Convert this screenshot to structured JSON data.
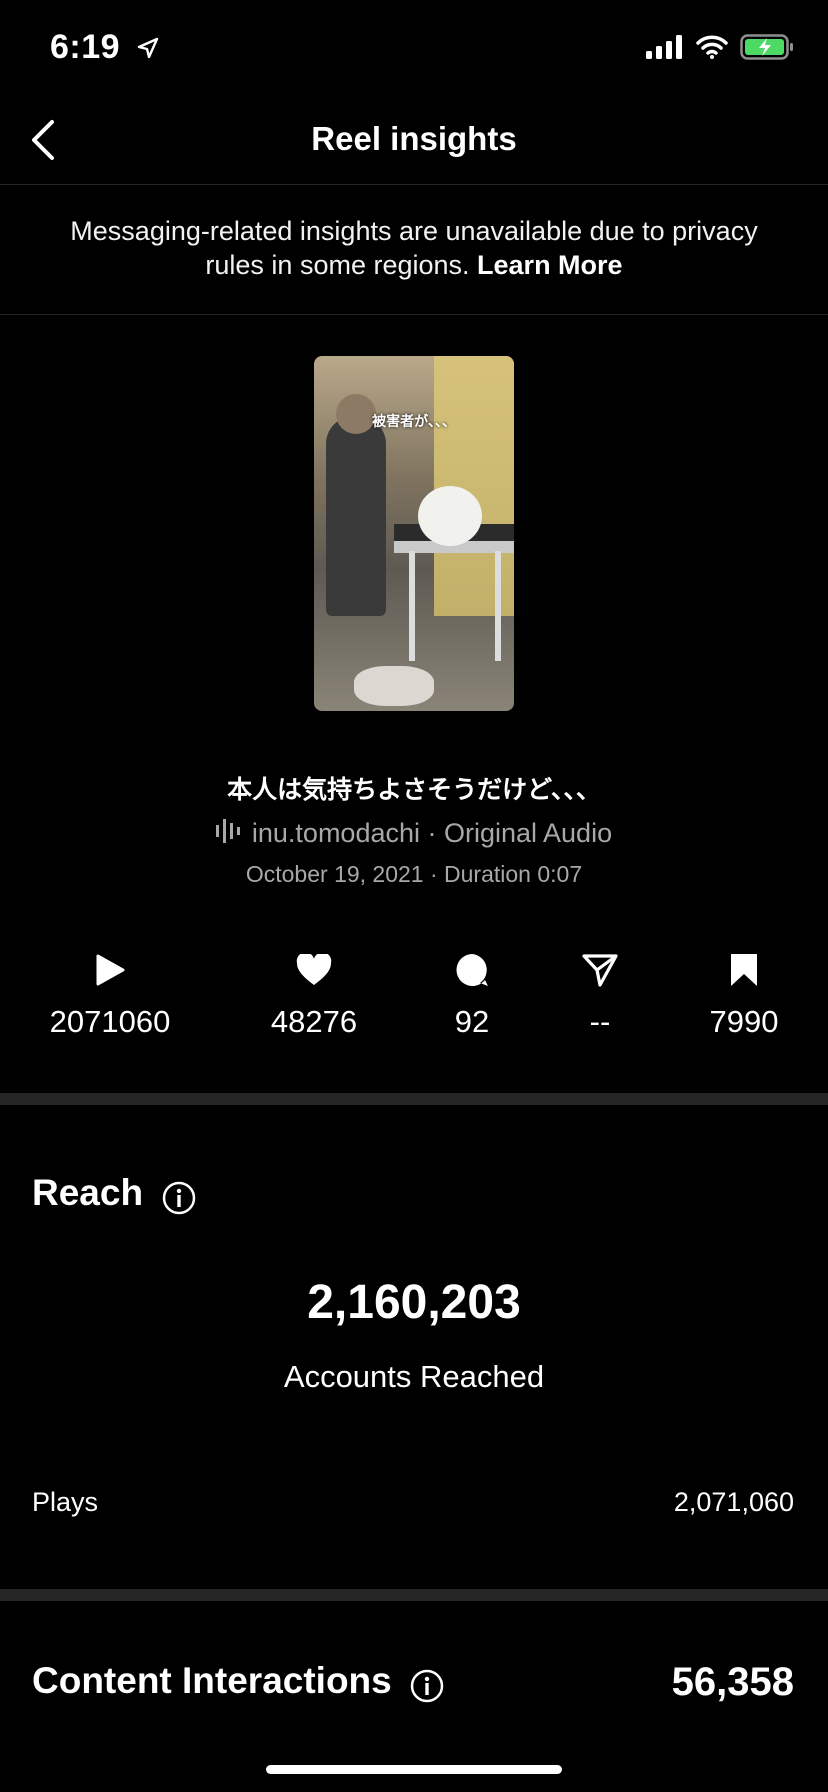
{
  "status_bar": {
    "time": "6:19",
    "location_icon": "location-arrow-icon",
    "signal_icon": "cellular-signal-icon",
    "wifi_icon": "wifi-icon",
    "battery_icon": "battery-charging-icon",
    "battery_color": "#4cd964"
  },
  "nav": {
    "back_icon": "chevron-left-icon",
    "title": "Reel insights"
  },
  "notice": {
    "text": "Messaging-related insights are unavailable due to privacy rules in some regions. ",
    "link": "Learn More"
  },
  "reel": {
    "thumbnail_caption": "被害者が、、、",
    "caption": "本人は気持ちよさそうだけど、、、",
    "audio": "inu.tomodachi · Original Audio",
    "date_duration": "October 19, 2021 · Duration 0:07"
  },
  "stats": [
    {
      "icon": "play-icon",
      "value": "2071060"
    },
    {
      "icon": "heart-icon",
      "value": "48276"
    },
    {
      "icon": "comment-icon",
      "value": "92"
    },
    {
      "icon": "share-icon",
      "value": "--"
    },
    {
      "icon": "bookmark-icon",
      "value": "7990"
    }
  ],
  "reach": {
    "title": "Reach",
    "accounts_reached": "2,160,203",
    "accounts_reached_label": "Accounts Reached",
    "plays_label": "Plays",
    "plays_value": "2,071,060"
  },
  "content_interactions": {
    "title": "Content Interactions",
    "value": "56,358"
  }
}
